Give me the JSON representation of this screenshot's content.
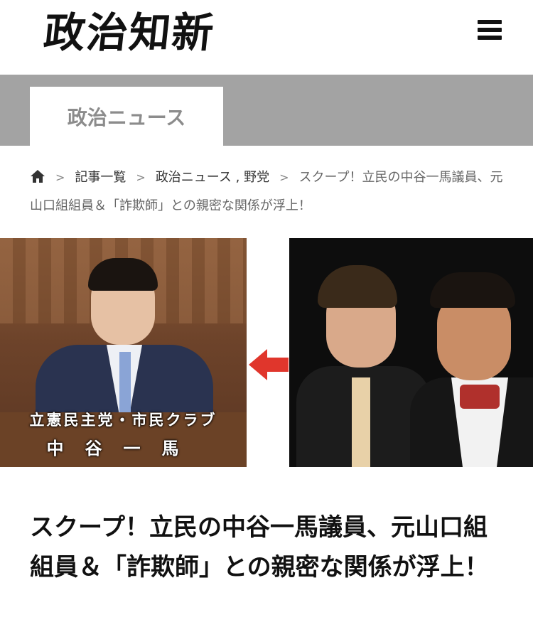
{
  "header": {
    "logo_text": "政治知新",
    "menu_icon": "hamburger-menu-icon"
  },
  "category": {
    "tab_label": "政治ニュース",
    "bar_color": "#a3a3a3"
  },
  "breadcrumb": {
    "home_icon": "home-icon",
    "items": [
      {
        "label": "記事一覧"
      },
      {
        "label": "政治ニュース"
      },
      {
        "label": "野党"
      }
    ],
    "joiner": ",",
    "current": "スクープ！立民の中谷一馬議員、元山口組組員＆「詐欺師」との親密な関係が浮上！"
  },
  "hero": {
    "left_caption_1": "立憲民主党・市民クラブ",
    "left_caption_2": "中谷一馬",
    "arrow_icon": "red-arrow-left-icon",
    "arrow_color": "#e0362c"
  },
  "article": {
    "title": "スクープ！立民の中谷一馬議員、元山口組組員＆「詐欺師」との親密な関係が浮上！"
  }
}
